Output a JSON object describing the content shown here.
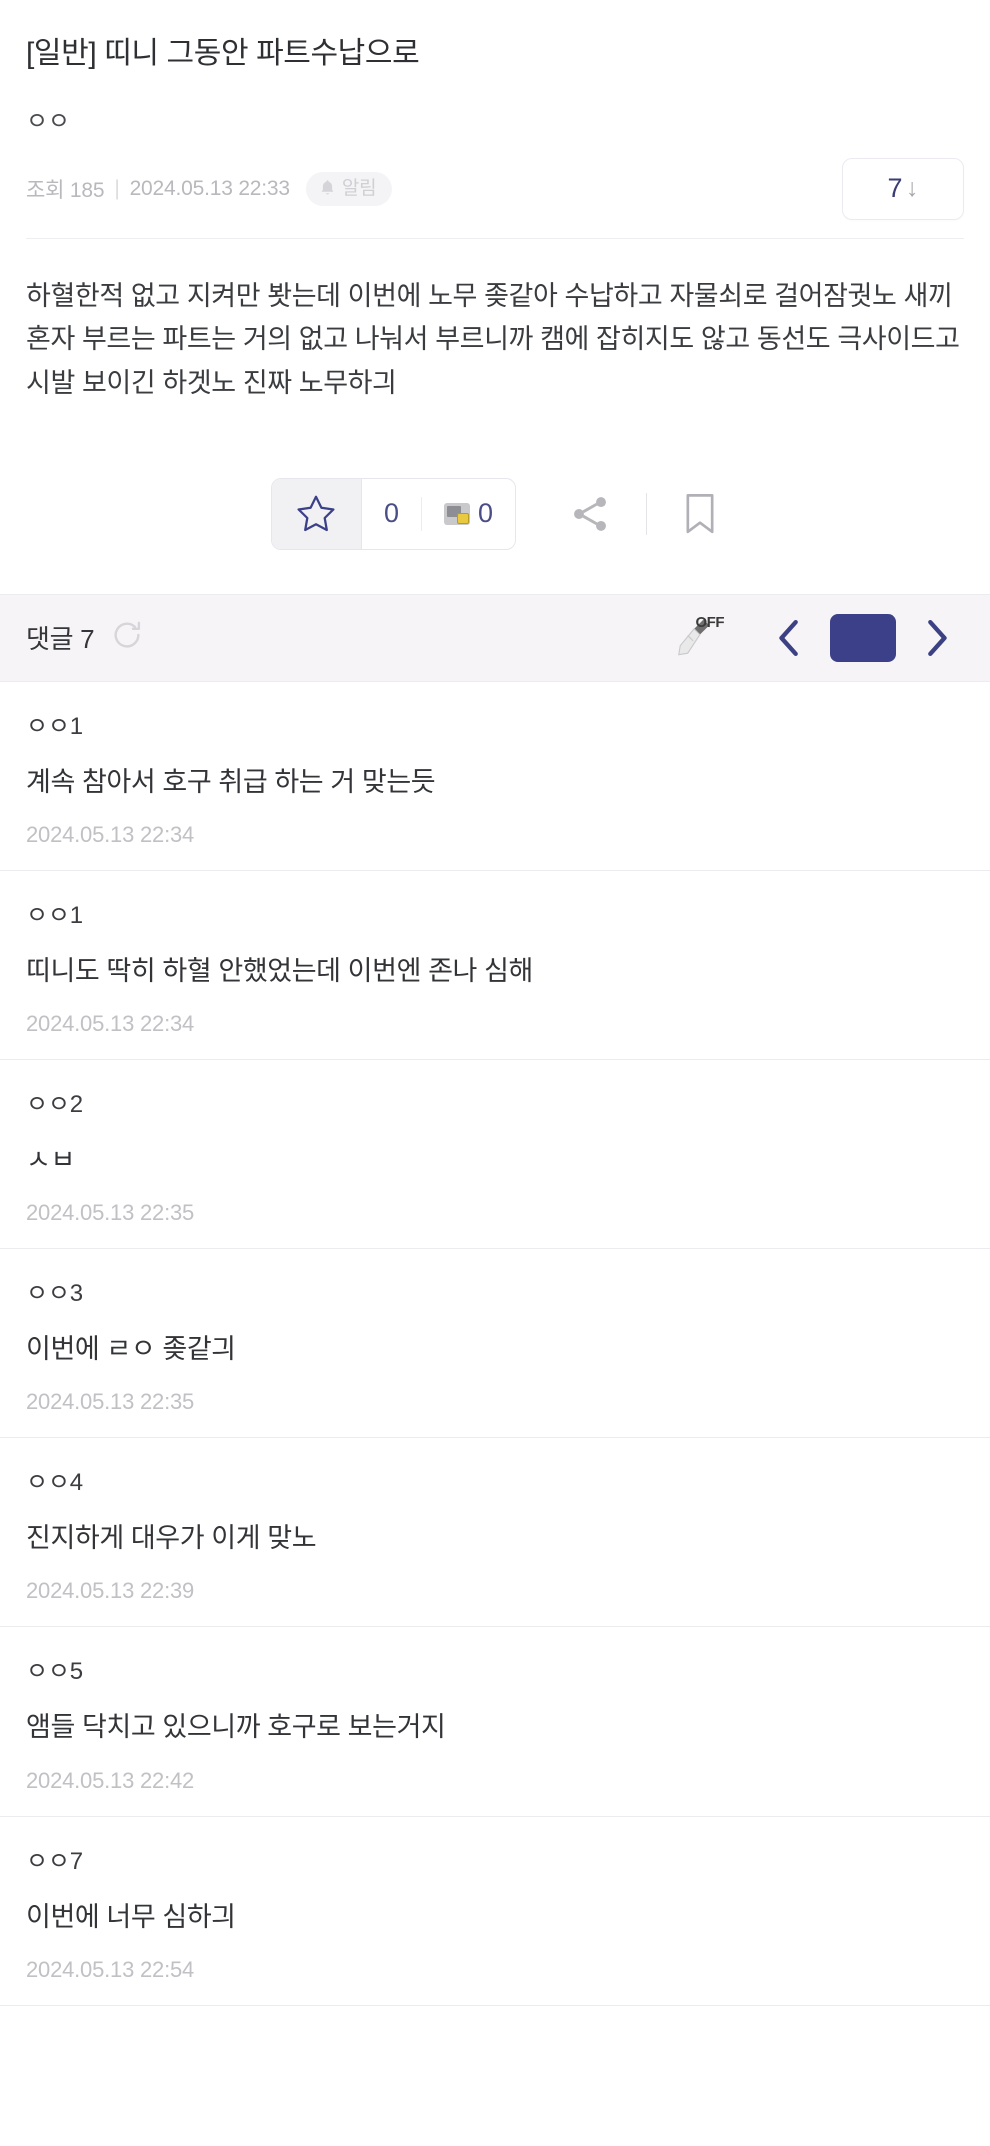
{
  "post": {
    "title": "[일반] 띠니 그동안 파트수납으로",
    "author": "ㅇㅇ",
    "views_label": "조회 185",
    "separator": "|",
    "date": "2024.05.13 22:33",
    "alarm_label": "알림",
    "vote_count": "7",
    "vote_arrow": "↓",
    "body": "하혈한적 없고 지켜만 봣는데 이번에 노무 좆같아 수납하고 자물쇠로 걸어잠궛노 새끼 혼자 부르는 파트는 거의 없고 나눠서 부르니까 캠에 잡히지도 않고 동선도 극사이드고 시발 보이긴 하겟노 진짜 노무하긔"
  },
  "actions": {
    "recommend_count": "0",
    "image_count": "0"
  },
  "comment_header": {
    "title": "댓글 7",
    "broom_label": "OFF"
  },
  "comments": [
    {
      "author": "ㅇㅇ1",
      "text": "계속 참아서 호구 취급 하는 거 맞는듯",
      "date": "2024.05.13 22:34"
    },
    {
      "author": "ㅇㅇ1",
      "text": "띠니도 딱히 하혈 안했었는데 이번엔 존나 심해",
      "date": "2024.05.13 22:34"
    },
    {
      "author": "ㅇㅇ2",
      "text": "ㅅㅂ",
      "date": "2024.05.13 22:35"
    },
    {
      "author": "ㅇㅇ3",
      "text": "이번에 ㄹㅇ 좆같긔",
      "date": "2024.05.13 22:35"
    },
    {
      "author": "ㅇㅇ4",
      "text": "진지하게 대우가 이게 맞노",
      "date": "2024.05.13 22:39"
    },
    {
      "author": "ㅇㅇ5",
      "text": "앰들 닥치고 있으니까 호구로 보는거지",
      "date": "2024.05.13 22:42"
    },
    {
      "author": "ㅇㅇ7",
      "text": "이번에 너무 심하긔",
      "date": "2024.05.13 22:54"
    }
  ],
  "colors": {
    "accent_navy": "#3b4088",
    "vote_text": "#3a3d73",
    "comment_bar_bg": "#f7f4f7",
    "muted_text": "#b9b9bd"
  }
}
